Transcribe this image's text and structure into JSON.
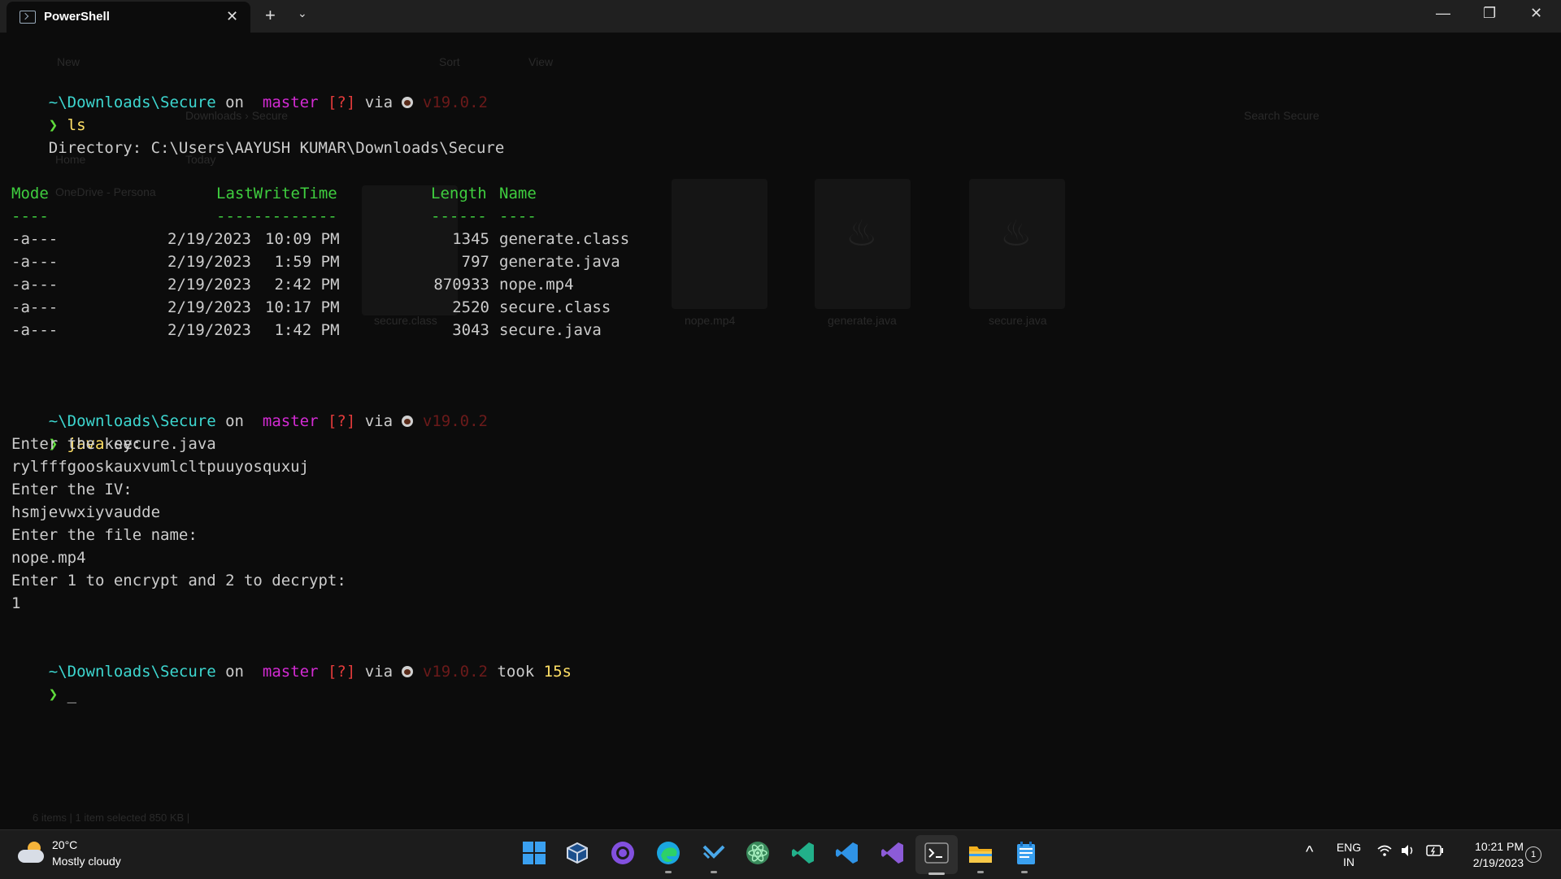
{
  "window": {
    "tab_title": "PowerShell",
    "close_glyph": "✕",
    "new_tab_glyph": "+",
    "dropdown_glyph": "⌄",
    "minimize_glyph": "—",
    "maximize_glyph": "❐",
    "win_close_glyph": "✕"
  },
  "ghost": {
    "new": "New",
    "sort": "Sort",
    "view": "View",
    "breadcrumb": "Downloads  ›  Secure",
    "search": "Search Secure",
    "home": "Home",
    "today": "Today",
    "onedrive": "OneDrive - Persona",
    "files": [
      "secure.class",
      "nope.mp4",
      "generate.java",
      "secure.java"
    ],
    "status": "6 items  |  1 item selected  850 KB  |"
  },
  "prompts": [
    {
      "path": "~\\Downloads\\Secure",
      "on": " on ",
      "branch_icon": "",
      "branch": " master",
      "status": " [?]",
      "via": " via ",
      "version": " v19.0.2",
      "took_label": "",
      "took_value": ""
    },
    {
      "path": "~\\Downloads\\Secure",
      "on": " on ",
      "branch_icon": "",
      "branch": " master",
      "status": " [?]",
      "via": " via ",
      "version": " v19.0.2",
      "took_label": "",
      "took_value": ""
    },
    {
      "path": "~\\Downloads\\Secure",
      "on": " on ",
      "branch_icon": "",
      "branch": " master",
      "status": " [?]",
      "via": " via ",
      "version": " v19.0.2",
      "took_label": " took ",
      "took_value": "15s"
    }
  ],
  "prompt_symbol": "❯",
  "commands": {
    "ls": "ls",
    "java_cmd": "java",
    "java_args": " secure.java"
  },
  "listing": {
    "directory": "    Directory: C:\\Users\\AAYUSH KUMAR\\Downloads\\Secure",
    "header_mode": "Mode",
    "header_time": "LastWriteTime",
    "header_length": "Length",
    "header_name": "Name",
    "sep_mode": "----",
    "sep_time": "-------------",
    "sep_length": "------",
    "sep_name": "----",
    "rows": [
      {
        "mode": "-a---",
        "date": "2/19/2023",
        "time": "10:09 PM",
        "length": "1345",
        "name": "generate.class"
      },
      {
        "mode": "-a---",
        "date": "2/19/2023",
        "time": " 1:59 PM",
        "length": "797",
        "name": "generate.java"
      },
      {
        "mode": "-a---",
        "date": "2/19/2023",
        "time": " 2:42 PM",
        "length": "870933",
        "name": "nope.mp4"
      },
      {
        "mode": "-a---",
        "date": "2/19/2023",
        "time": "10:17 PM",
        "length": "2520",
        "name": "secure.class"
      },
      {
        "mode": "-a---",
        "date": "2/19/2023",
        "time": " 1:42 PM",
        "length": "3043",
        "name": "secure.java"
      }
    ]
  },
  "output": [
    "Enter the key:",
    "rylfffgooskauxvumlcltpuuyosquxuj",
    "Enter the IV:",
    "hsmjevwxiyvaudde",
    "Enter the file name:",
    "nope.mp4",
    "Enter 1 to encrypt and 2 to decrypt:",
    "1"
  ],
  "cursor": "_",
  "taskbar": {
    "temperature": "20°C",
    "condition": "Mostly cloudy",
    "lang_line1": "ENG",
    "lang_line2": "IN",
    "time": "10:21 PM",
    "date": "2/19/2023",
    "notifications": "1",
    "tray_chevron": "^",
    "apps": [
      {
        "name": "start-icon"
      },
      {
        "name": "virtualbox-icon"
      },
      {
        "name": "github-desktop-icon"
      },
      {
        "name": "edge-icon"
      },
      {
        "name": "mail-icon"
      },
      {
        "name": "atom-icon"
      },
      {
        "name": "vscode-insiders-icon"
      },
      {
        "name": "vscode-icon"
      },
      {
        "name": "visual-studio-icon"
      },
      {
        "name": "terminal-icon"
      },
      {
        "name": "file-explorer-icon"
      },
      {
        "name": "notepad-icon"
      }
    ]
  },
  "colors": {
    "path": "#3dd7d0",
    "branch": "#d42bd4",
    "status": "#e23b3b",
    "prompt": "#5fdc3c",
    "header": "#3fce3f",
    "command": "#ffe066"
  }
}
